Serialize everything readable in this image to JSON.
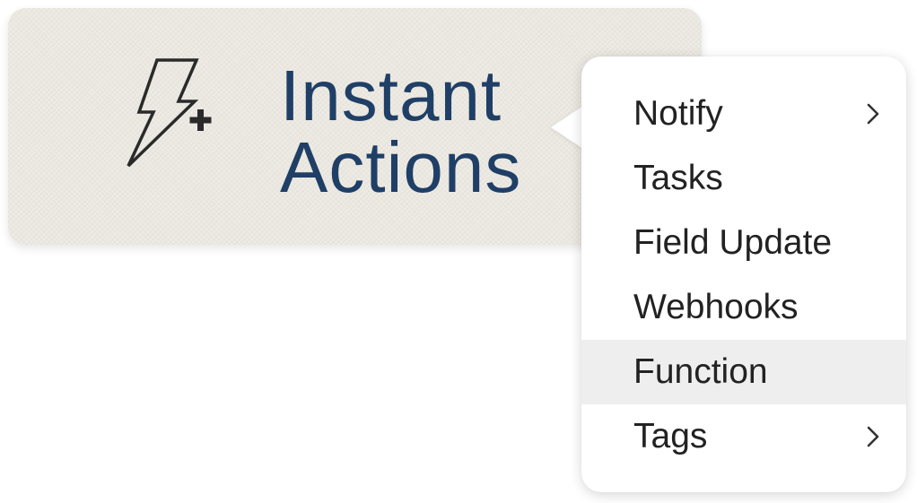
{
  "card": {
    "icon": "lightning-bolt-plus-icon",
    "title_line1": "Instant",
    "title_line2": "Actions",
    "title_color": "#1f3f66",
    "background_color": "#ebe8e1"
  },
  "menu": {
    "items": [
      {
        "label": "Notify",
        "has_submenu": true,
        "highlighted": false
      },
      {
        "label": "Tasks",
        "has_submenu": false,
        "highlighted": false
      },
      {
        "label": "Field Update",
        "has_submenu": false,
        "highlighted": false
      },
      {
        "label": "Webhooks",
        "has_submenu": false,
        "highlighted": false
      },
      {
        "label": "Function",
        "has_submenu": false,
        "highlighted": true
      },
      {
        "label": "Tags",
        "has_submenu": true,
        "highlighted": false
      }
    ],
    "submenu_icon": "chevron-right-icon",
    "highlight_color": "#eeeeee"
  }
}
